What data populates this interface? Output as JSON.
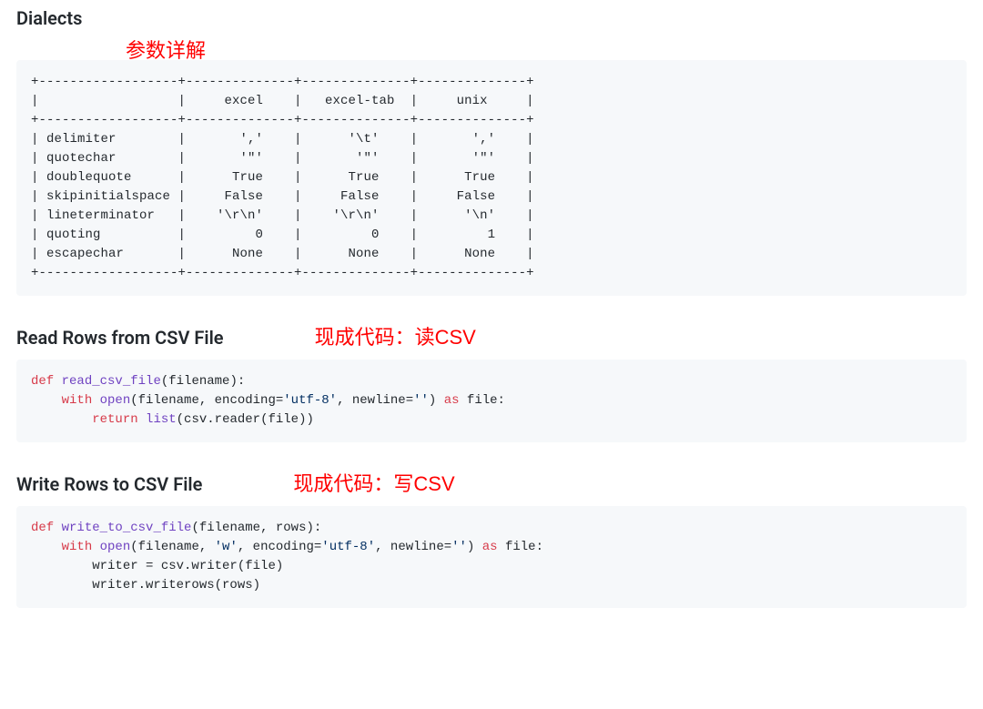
{
  "section1": {
    "heading": "Dialects",
    "annotation": "参数详解",
    "table_text": "+------------------+--------------+--------------+--------------+\n|                  |     excel    |   excel-tab  |     unix     |\n+------------------+--------------+--------------+--------------+\n| delimiter        |       ','    |      '\\t'    |       ','    |\n| quotechar        |       '\"'    |       '\"'    |       '\"'    |\n| doublequote      |      True    |      True    |      True    |\n| skipinitialspace |     False    |     False    |     False    |\n| lineterminator   |    '\\r\\n'    |    '\\r\\n'    |      '\\n'    |\n| quoting          |         0    |         0    |         1    |\n| escapechar       |      None    |      None    |      None    |\n+------------------+--------------+--------------+--------------+"
  },
  "section2": {
    "heading": "Read Rows from CSV File",
    "annotation": "现成代码：读CSV",
    "code": {
      "kw_def": "def",
      "fn_name": "read_csv_file",
      "sig_rest": "(filename):",
      "kw_with": "with",
      "fn_open": "open",
      "open_args_start": "(filename, encoding=",
      "str_utf8": "'utf-8'",
      "mid1": ", newline=",
      "str_empty": "''",
      "mid2": ") ",
      "kw_as": "as",
      "mid3": " file:",
      "kw_return": "return",
      "fn_list": "list",
      "ret_rest": "(csv.reader(file))"
    }
  },
  "section3": {
    "heading": "Write Rows to CSV File",
    "annotation": "现成代码：写CSV",
    "code": {
      "kw_def": "def",
      "fn_name": "write_to_csv_file",
      "sig_rest": "(filename, rows):",
      "kw_with": "with",
      "fn_open": "open",
      "open_args_start": "(filename, ",
      "str_w": "'w'",
      "mid0": ", encoding=",
      "str_utf8": "'utf-8'",
      "mid1": ", newline=",
      "str_empty": "''",
      "mid2": ") ",
      "kw_as": "as",
      "mid3": " file:",
      "line3_pre": "        writer = csv.writer(file)",
      "line4_pre": "        writer.writerows(rows)"
    }
  },
  "chart_data": {
    "type": "table",
    "title": "Dialects",
    "columns": [
      "",
      "excel",
      "excel-tab",
      "unix"
    ],
    "rows": [
      {
        "param": "delimiter",
        "excel": "','",
        "excel-tab": "'\\t'",
        "unix": "','"
      },
      {
        "param": "quotechar",
        "excel": "'\"'",
        "excel-tab": "'\"'",
        "unix": "'\"'"
      },
      {
        "param": "doublequote",
        "excel": "True",
        "excel-tab": "True",
        "unix": "True"
      },
      {
        "param": "skipinitialspace",
        "excel": "False",
        "excel-tab": "False",
        "unix": "False"
      },
      {
        "param": "lineterminator",
        "excel": "'\\r\\n'",
        "excel-tab": "'\\r\\n'",
        "unix": "'\\n'"
      },
      {
        "param": "quoting",
        "excel": "0",
        "excel-tab": "0",
        "unix": "1"
      },
      {
        "param": "escapechar",
        "excel": "None",
        "excel-tab": "None",
        "unix": "None"
      }
    ]
  }
}
